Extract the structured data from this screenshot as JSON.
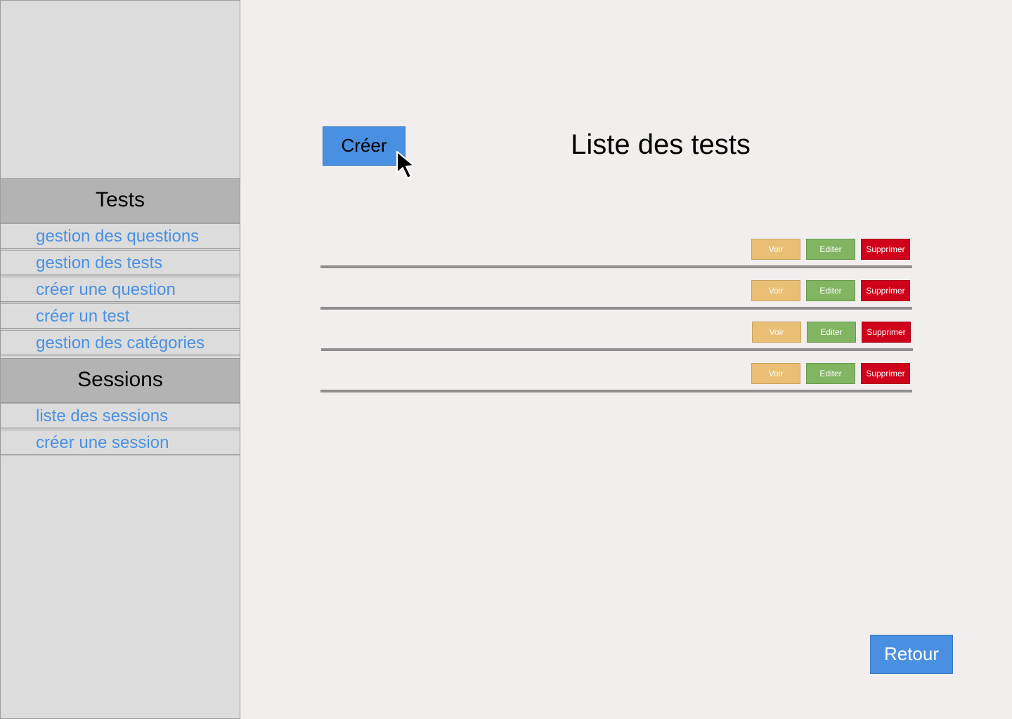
{
  "sidebar": {
    "sections": [
      {
        "title": "Tests",
        "items": [
          {
            "label": "gestion des questions"
          },
          {
            "label": "gestion des tests"
          },
          {
            "label": "créer une question"
          },
          {
            "label": "créer un test"
          },
          {
            "label": "gestion des catégories"
          }
        ]
      },
      {
        "title": "Sessions",
        "items": [
          {
            "label": "liste des sessions"
          },
          {
            "label": "créer une session"
          }
        ]
      }
    ]
  },
  "main": {
    "create_label": "Créer",
    "title": "Liste des tests",
    "rows": [
      {
        "view_label": "Voir",
        "edit_label": "Editer",
        "delete_label": "Supprimer"
      },
      {
        "view_label": "Voir",
        "edit_label": "Editer",
        "delete_label": "Supprimer"
      },
      {
        "view_label": "Voir",
        "edit_label": "Editer",
        "delete_label": "Supprimer"
      },
      {
        "view_label": "Voir",
        "edit_label": "Editer",
        "delete_label": "Supprimer"
      }
    ],
    "back_label": "Retour"
  },
  "colors": {
    "primary": "#4a90e2",
    "view": "#e9bf75",
    "edit": "#82b562",
    "delete": "#d0021b",
    "sidebar_bg": "#dcdcdc",
    "section_header_bg": "#b3b3b3",
    "page_bg": "#f1eeed"
  },
  "icons": {
    "cursor": "mouse-pointer-icon"
  }
}
